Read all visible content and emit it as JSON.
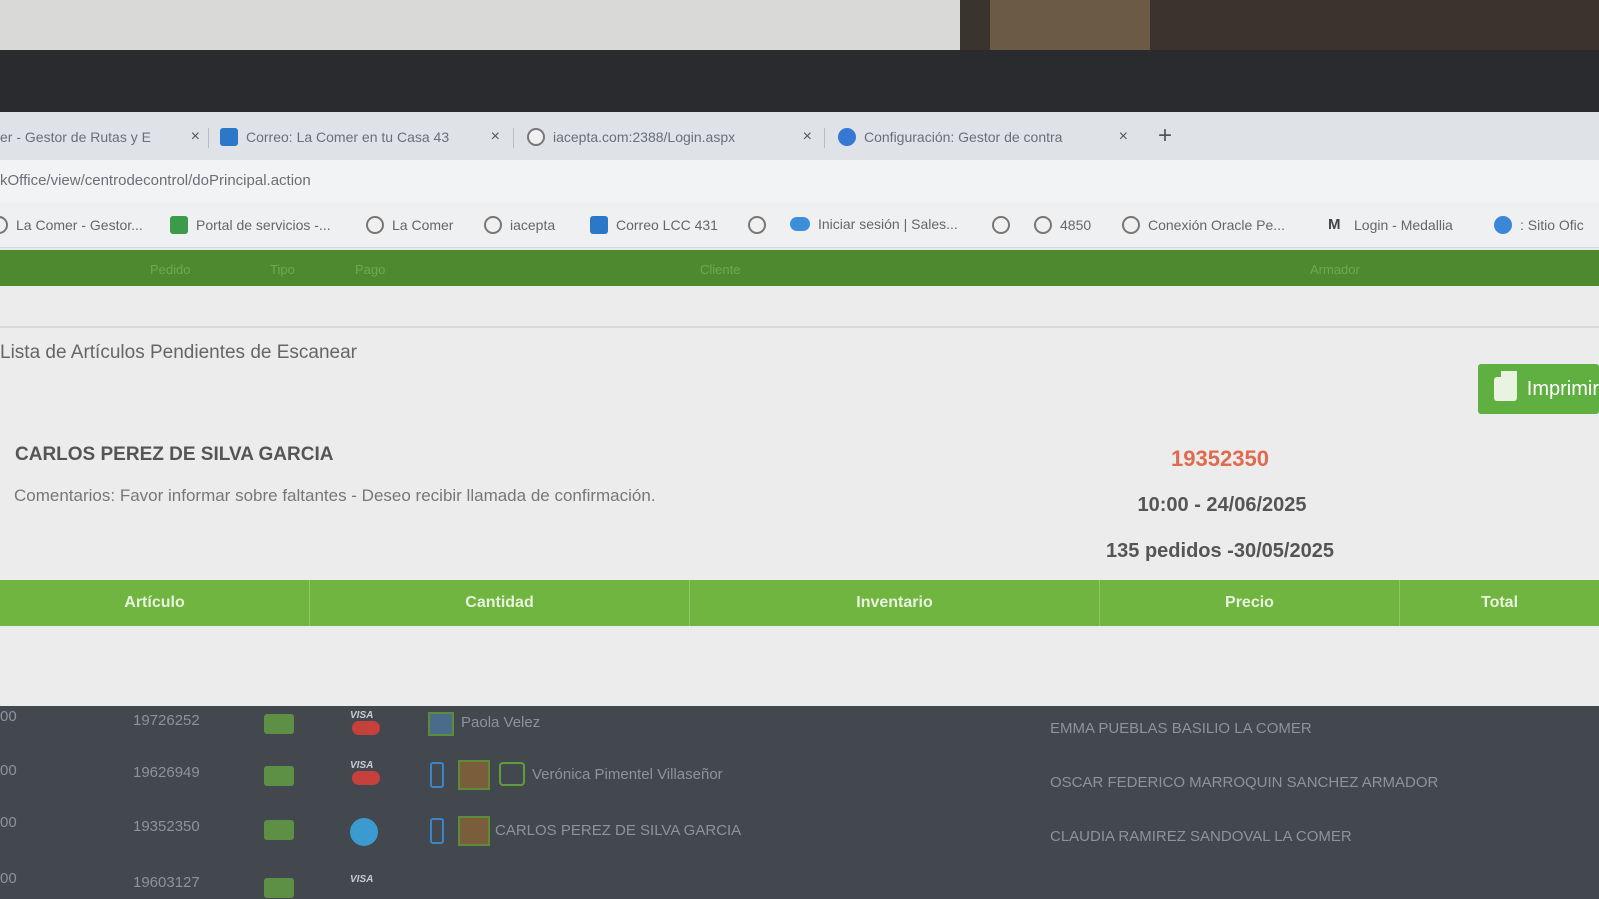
{
  "browser": {
    "tabs": [
      {
        "label": "er - Gestor de Rutas y E",
        "icon": "globe-icon"
      },
      {
        "label": "Correo: La Comer en tu Casa 43",
        "icon": "outlook-icon"
      },
      {
        "label": "iacepta.com:2388/Login.aspx",
        "icon": "globe-icon"
      },
      {
        "label": "Configuración: Gestor de contra",
        "icon": "gear-icon"
      }
    ],
    "tab_close": "×",
    "new_tab": "+",
    "url": "kOffice/view/centrodecontrol/doPrincipal.action",
    "bookmarks": [
      {
        "label": "La Comer - Gestor...",
        "icon": "globe-icon"
      },
      {
        "label": "Portal de servicios -...",
        "icon": "portal-icon"
      },
      {
        "label": "La Comer",
        "icon": "globe-icon"
      },
      {
        "label": "iacepta",
        "icon": "globe-icon"
      },
      {
        "label": "Correo LCC 431",
        "icon": "outlook-icon"
      },
      {
        "label": "",
        "icon": "globe-icon"
      },
      {
        "label": "Iniciar sesión | Sales...",
        "icon": "cloud-icon"
      },
      {
        "label": "",
        "icon": "globe-icon"
      },
      {
        "label": "4850",
        "icon": "globe-icon"
      },
      {
        "label": "Conexión Oracle Pe...",
        "icon": "globe-icon"
      },
      {
        "label": "Login - Medallia",
        "icon": "medallia-icon"
      },
      {
        "label": ": Sitio Ofic",
        "icon": "world-icon"
      }
    ]
  },
  "app_header": {
    "columns": [
      "Pedido",
      "Tipo",
      "Pago",
      "Cliente",
      "Armador"
    ]
  },
  "page": {
    "title": "Lista de Artículos Pendientes de Escanear",
    "print_button": "Imprimir",
    "customer": "CARLOS PEREZ DE SILVA GARCIA",
    "comments": "Comentarios: Favor informar sobre faltantes - Deseo recibir llamada de confirmación.",
    "order_number": "19352350",
    "delivery_slot": "10:00 - 24/06/2025",
    "orders_count": "135 pedidos -30/05/2025",
    "table_headers": [
      "Artículo",
      "Cantidad",
      "Inventario",
      "Precio",
      "Total"
    ]
  },
  "background_rows": [
    {
      "prefix": "00",
      "order": "19726252",
      "client": "Paola Velez",
      "assembler": "EMMA PUEBLAS BASILIO LA COMER"
    },
    {
      "prefix": "00",
      "order": "19626949",
      "client": "Verónica Pimentel Villaseñor",
      "assembler": "OSCAR FEDERICO MARROQUIN SANCHEZ ARMADOR"
    },
    {
      "prefix": "00",
      "order": "19352350",
      "client": "CARLOS PEREZ DE SILVA GARCIA",
      "assembler": "CLAUDIA RAMIREZ SANDOVAL LA COMER"
    },
    {
      "prefix": "00",
      "order": "19603127",
      "client": "",
      "assembler": ""
    }
  ],
  "colors": {
    "accent_green": "#6fb53f",
    "header_green": "#4d8a2f",
    "order_red": "#e06a4e"
  }
}
